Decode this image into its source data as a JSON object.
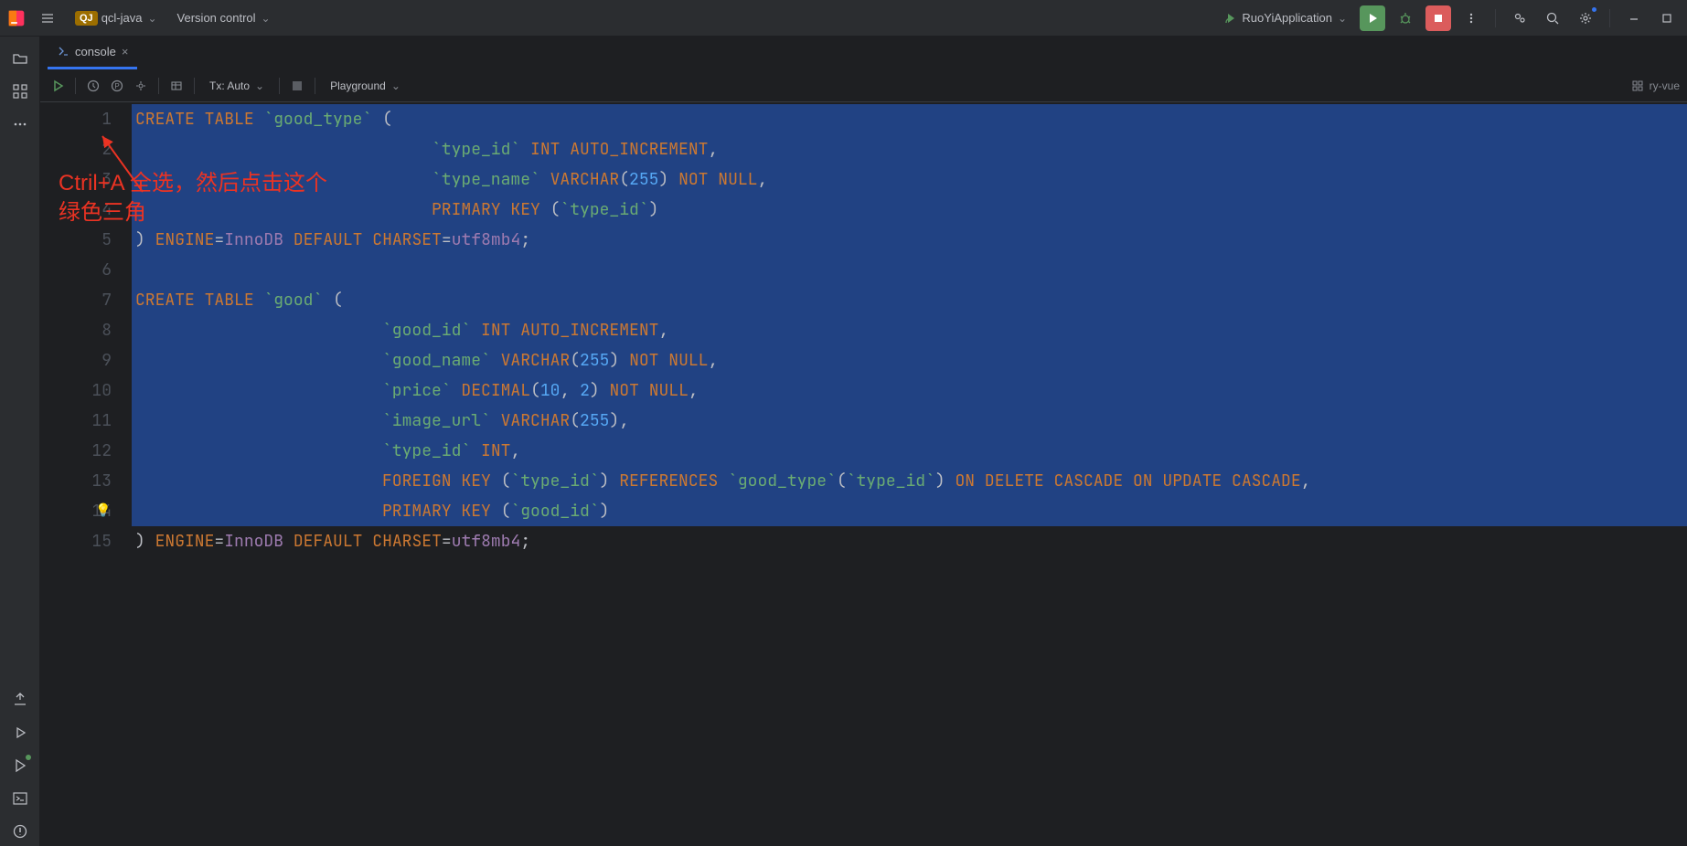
{
  "titlebar": {
    "project": "qcl-java",
    "project_badge": "QJ",
    "vcs": "Version control",
    "run_config": "RuoYiApplication"
  },
  "tabs": [
    {
      "label": "console"
    }
  ],
  "editor_toolbar": {
    "tx": "Tx: Auto",
    "playground": "Playground",
    "datasource": "ry-vue"
  },
  "annotation": {
    "line1": "Ctril+A 全选，然后点击这个",
    "line2": "绿色三角"
  },
  "code": {
    "lines": [
      {
        "n": 1,
        "sel": true,
        "tokens": [
          [
            "kw",
            "CREATE"
          ],
          [
            "op",
            " "
          ],
          [
            "kw",
            "TABLE"
          ],
          [
            "op",
            " "
          ],
          [
            "backtick",
            "`good_type`"
          ],
          [
            "op",
            " ("
          ]
        ]
      },
      {
        "n": 2,
        "sel": true,
        "tokens": [
          [
            "op",
            "                              "
          ],
          [
            "backtick",
            "`type_id`"
          ],
          [
            "op",
            " "
          ],
          [
            "kw",
            "INT"
          ],
          [
            "op",
            " "
          ],
          [
            "kw",
            "AUTO_INCREMENT"
          ],
          [
            "op",
            ","
          ]
        ]
      },
      {
        "n": 3,
        "sel": true,
        "tokens": [
          [
            "op",
            "                              "
          ],
          [
            "backtick",
            "`type_name`"
          ],
          [
            "op",
            " "
          ],
          [
            "kw",
            "VARCHAR"
          ],
          [
            "op",
            "("
          ],
          [
            "num",
            "255"
          ],
          [
            "op",
            ") "
          ],
          [
            "kw",
            "NOT"
          ],
          [
            "op",
            " "
          ],
          [
            "kw",
            "NULL"
          ],
          [
            "op",
            ","
          ]
        ]
      },
      {
        "n": 4,
        "sel": true,
        "tokens": [
          [
            "op",
            "                              "
          ],
          [
            "kw",
            "PRIMARY"
          ],
          [
            "op",
            " "
          ],
          [
            "kw",
            "KEY"
          ],
          [
            "op",
            " ("
          ],
          [
            "backtick",
            "`type_id`"
          ],
          [
            "op",
            ")"
          ]
        ]
      },
      {
        "n": 5,
        "sel": true,
        "tokens": [
          [
            "op",
            ") "
          ],
          [
            "kw",
            "ENGINE"
          ],
          [
            "op",
            "="
          ],
          [
            "id",
            "InnoDB"
          ],
          [
            "op",
            " "
          ],
          [
            "kw",
            "DEFAULT"
          ],
          [
            "op",
            " "
          ],
          [
            "kw",
            "CHARSET"
          ],
          [
            "op",
            "="
          ],
          [
            "id",
            "utf8mb4"
          ],
          [
            "op",
            ";"
          ]
        ]
      },
      {
        "n": 6,
        "sel": true,
        "tokens": [
          [
            "op",
            ""
          ]
        ]
      },
      {
        "n": 7,
        "sel": true,
        "tokens": [
          [
            "kw",
            "CREATE"
          ],
          [
            "op",
            " "
          ],
          [
            "kw",
            "TABLE"
          ],
          [
            "op",
            " "
          ],
          [
            "backtick",
            "`good`"
          ],
          [
            "op",
            " ("
          ]
        ]
      },
      {
        "n": 8,
        "sel": true,
        "tokens": [
          [
            "op",
            "                         "
          ],
          [
            "backtick",
            "`good_id`"
          ],
          [
            "op",
            " "
          ],
          [
            "kw",
            "INT"
          ],
          [
            "op",
            " "
          ],
          [
            "kw",
            "AUTO_INCREMENT"
          ],
          [
            "op",
            ","
          ]
        ]
      },
      {
        "n": 9,
        "sel": true,
        "tokens": [
          [
            "op",
            "                         "
          ],
          [
            "backtick",
            "`good_name`"
          ],
          [
            "op",
            " "
          ],
          [
            "kw",
            "VARCHAR"
          ],
          [
            "op",
            "("
          ],
          [
            "num",
            "255"
          ],
          [
            "op",
            ") "
          ],
          [
            "kw",
            "NOT"
          ],
          [
            "op",
            " "
          ],
          [
            "kw",
            "NULL"
          ],
          [
            "op",
            ","
          ]
        ]
      },
      {
        "n": 10,
        "sel": true,
        "tokens": [
          [
            "op",
            "                         "
          ],
          [
            "backtick",
            "`price`"
          ],
          [
            "op",
            " "
          ],
          [
            "kw",
            "DECIMAL"
          ],
          [
            "op",
            "("
          ],
          [
            "num",
            "10"
          ],
          [
            "op",
            ", "
          ],
          [
            "num",
            "2"
          ],
          [
            "op",
            ") "
          ],
          [
            "kw",
            "NOT"
          ],
          [
            "op",
            " "
          ],
          [
            "kw",
            "NULL"
          ],
          [
            "op",
            ","
          ]
        ]
      },
      {
        "n": 11,
        "sel": true,
        "tokens": [
          [
            "op",
            "                         "
          ],
          [
            "backtick",
            "`image_url`"
          ],
          [
            "op",
            " "
          ],
          [
            "kw",
            "VARCHAR"
          ],
          [
            "op",
            "("
          ],
          [
            "num",
            "255"
          ],
          [
            "op",
            "),"
          ]
        ]
      },
      {
        "n": 12,
        "sel": true,
        "tokens": [
          [
            "op",
            "                         "
          ],
          [
            "backtick",
            "`type_id`"
          ],
          [
            "op",
            " "
          ],
          [
            "kw",
            "INT"
          ],
          [
            "op",
            ","
          ]
        ]
      },
      {
        "n": 13,
        "sel": true,
        "tokens": [
          [
            "op",
            "                         "
          ],
          [
            "kw",
            "FOREIGN"
          ],
          [
            "op",
            " "
          ],
          [
            "kw",
            "KEY"
          ],
          [
            "op",
            " ("
          ],
          [
            "backtick",
            "`type_id`"
          ],
          [
            "op",
            ") "
          ],
          [
            "kw",
            "REFERENCES"
          ],
          [
            "op",
            " "
          ],
          [
            "backtick",
            "`good_type`"
          ],
          [
            "op",
            "("
          ],
          [
            "backtick",
            "`type_id`"
          ],
          [
            "op",
            ") "
          ],
          [
            "kw",
            "ON"
          ],
          [
            "op",
            " "
          ],
          [
            "kw",
            "DELETE"
          ],
          [
            "op",
            " "
          ],
          [
            "kw",
            "CASCADE"
          ],
          [
            "op",
            " "
          ],
          [
            "kw",
            "ON"
          ],
          [
            "op",
            " "
          ],
          [
            "kw",
            "UPDATE"
          ],
          [
            "op",
            " "
          ],
          [
            "kw",
            "CASCADE"
          ],
          [
            "op",
            ","
          ]
        ]
      },
      {
        "n": 14,
        "sel": true,
        "tokens": [
          [
            "op",
            "                         "
          ],
          [
            "kw",
            "PRIMARY"
          ],
          [
            "op",
            " "
          ],
          [
            "kw",
            "KEY"
          ],
          [
            "op",
            " ("
          ],
          [
            "backtick",
            "`good_id`"
          ],
          [
            "op",
            ")"
          ]
        ]
      },
      {
        "n": 15,
        "sel": false,
        "tokens": [
          [
            "op",
            ") "
          ],
          [
            "kw",
            "ENGINE"
          ],
          [
            "op",
            "="
          ],
          [
            "id",
            "InnoDB"
          ],
          [
            "op",
            " "
          ],
          [
            "kw",
            "DEFAULT"
          ],
          [
            "op",
            " "
          ],
          [
            "kw",
            "CHARSET"
          ],
          [
            "op",
            "="
          ],
          [
            "id",
            "utf8mb4"
          ],
          [
            "op",
            ";"
          ]
        ]
      }
    ]
  }
}
